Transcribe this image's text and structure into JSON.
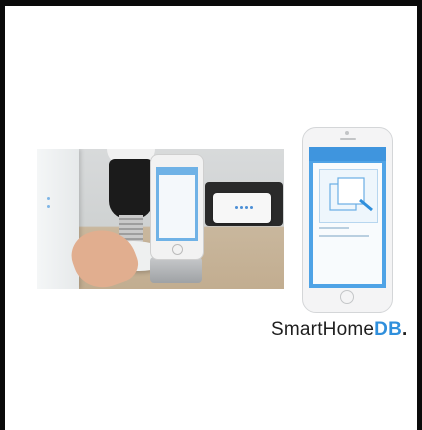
{
  "brand": {
    "name_part1": "SmartHome",
    "name_part2": "DB",
    "dot": ".",
    "accent_color": "#2f8fdc"
  },
  "images": {
    "product_photo": "smart-plug-with-bulb-and-phone-photo",
    "phone_mockup": "phone-app-screen-mockup"
  }
}
